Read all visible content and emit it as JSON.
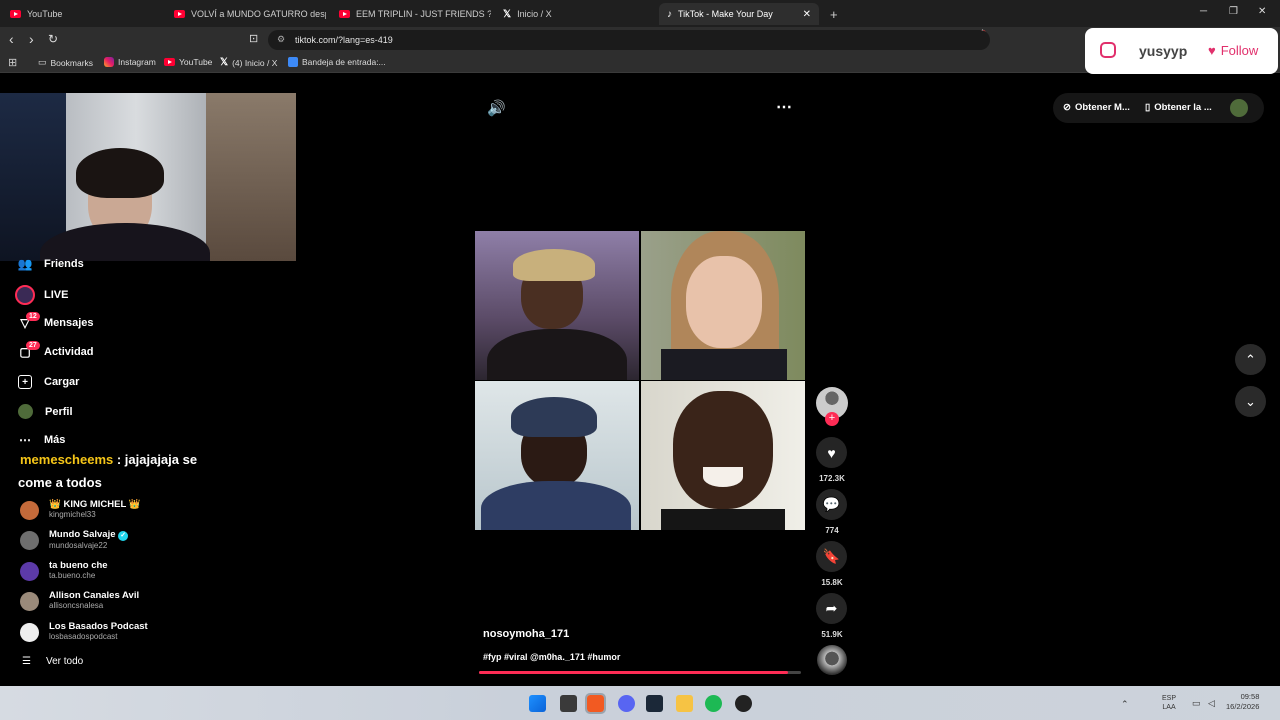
{
  "browser": {
    "tabs": [
      {
        "label": "YouTube",
        "icon": "youtube-icon"
      },
      {
        "label": "VOLVÍ a MUNDO GATURRO después",
        "icon": "youtube-icon"
      },
      {
        "label": "EEM TRIPLIN - JUST FRIENDS ? (OFFI",
        "icon": "youtube-icon"
      },
      {
        "label": "Inicio / X",
        "icon": "x-icon"
      },
      {
        "label": "TikTok - Make Your Day",
        "icon": "tiktok-icon"
      }
    ],
    "url": "tiktok.com/?lang=es-419",
    "bookmarks": [
      {
        "label": "Bookmarks"
      },
      {
        "label": "Instagram"
      },
      {
        "label": "YouTube"
      },
      {
        "label": "(4) Inicio / X"
      },
      {
        "label": "Bandeja de entrada:..."
      }
    ],
    "ext_badge": "1"
  },
  "overlay": {
    "username": "yusyyp",
    "follow_label": "Follow"
  },
  "header": {
    "get_app_label": "Obtener M...",
    "get_desktop_label": "Obtener la ..."
  },
  "sidebar": {
    "items": [
      {
        "label": "Friends"
      },
      {
        "label": "LIVE"
      },
      {
        "label": "Mensajes",
        "badge": "12"
      },
      {
        "label": "Actividad",
        "badge": "27"
      },
      {
        "label": "Cargar"
      },
      {
        "label": "Perfil"
      },
      {
        "label": "Más"
      }
    ],
    "following": [
      {
        "name": "KING MICHEL",
        "user": "kingmichel33",
        "crown": "👑"
      },
      {
        "name": "Mundo Salvaje",
        "user": "mundosalvaje22",
        "verified": "✓"
      },
      {
        "name": "ta bueno che",
        "user": "ta.bueno.che"
      },
      {
        "name": "Allison Canales Avil",
        "user": "allisoncsnalesa"
      },
      {
        "name": "Los Basados Podcast",
        "user": "losbasadospodcast"
      }
    ],
    "see_all": "Ver todo"
  },
  "chat": {
    "user": "memescheems",
    "sep": " : ",
    "message": "jajajajaja se",
    "message2": "come a todos"
  },
  "video": {
    "author": "nosoymoha_171",
    "caption": "#fyp #viral @m0ha._171 #humor",
    "likes": "172.3K",
    "comments": "774",
    "saves": "15.8K",
    "shares": "51.9K",
    "progress": 0.96
  },
  "taskbar": {
    "lang": "ESP",
    "lang2": "LAA",
    "time": "09:58",
    "date": "16/2/2026"
  },
  "colors": {
    "accent": "#fe2c55",
    "chat_name": "#f5c518"
  }
}
